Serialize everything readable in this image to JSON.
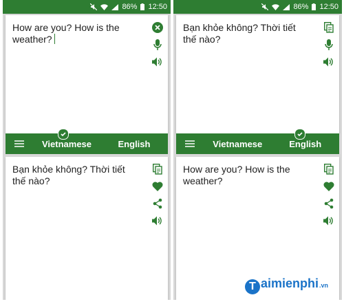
{
  "colors": {
    "accent": "#2e7d32",
    "background": "#d8d8d8",
    "card": "#ffffff",
    "text": "#212121"
  },
  "status_bar": {
    "battery": "86%",
    "time": "12:50",
    "icons": [
      "mute-icon",
      "wifi-icon",
      "signal-icon",
      "battery-icon"
    ]
  },
  "left_screen": {
    "input_text": "How are you? How is the weather?",
    "source_language": "Vietnamese",
    "target_language": "English",
    "selected_language": "target",
    "output_text": "Bạn khỏe không? Thời tiết thế nào?",
    "input_actions": [
      "close-icon",
      "mic-icon",
      "speaker-icon"
    ],
    "output_actions": [
      "copy-icon",
      "heart-icon",
      "share-icon",
      "speaker-icon"
    ]
  },
  "right_screen": {
    "input_text": "Bạn khỏe không? Thời tiết thế nào?",
    "source_language": "Vietnamese",
    "target_language": "English",
    "selected_language": "target",
    "output_text": "How are you? How is the weather?",
    "input_actions": [
      "copy-icon",
      "mic-icon",
      "speaker-icon"
    ],
    "output_actions": [
      "copy-icon",
      "heart-icon",
      "share-icon",
      "speaker-icon"
    ]
  },
  "watermark": {
    "logo_letter": "T",
    "text": "aimienphi",
    "suffix": ".vn"
  }
}
